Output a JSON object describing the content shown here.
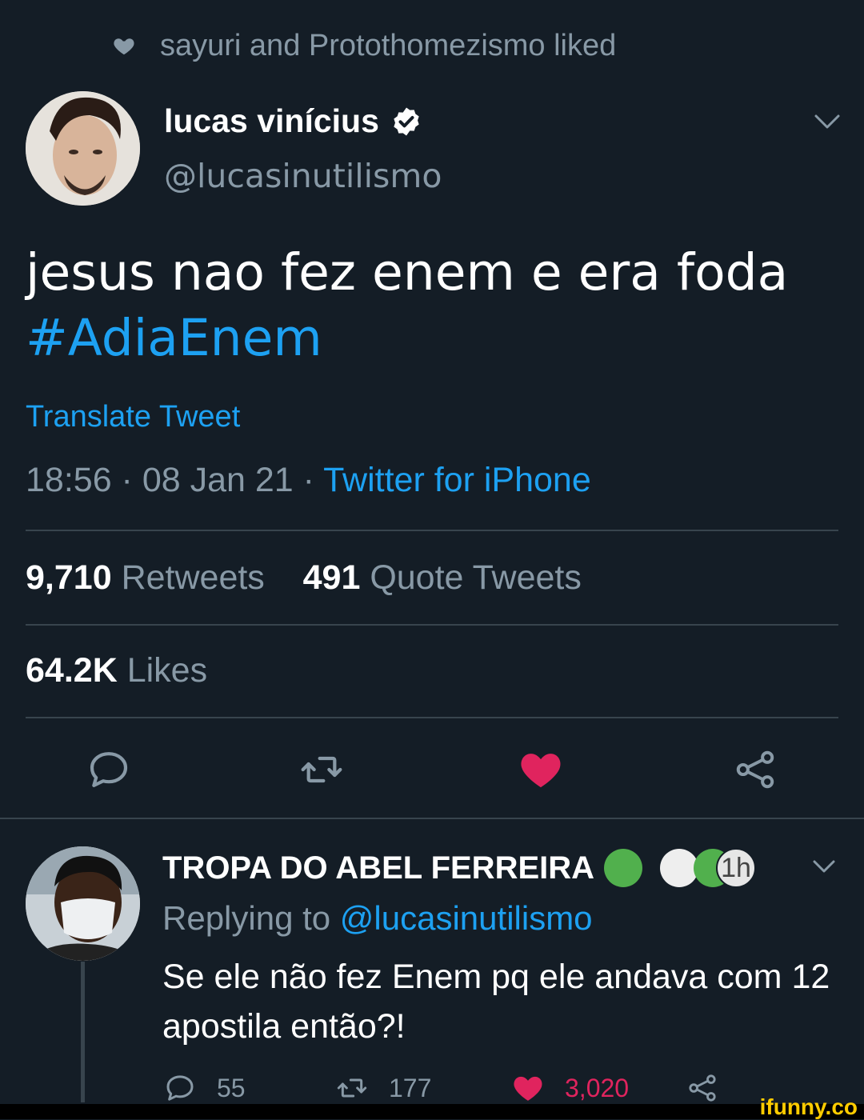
{
  "social_context": {
    "text": "sayuri and Protothomezismo liked",
    "icon": "heart-icon"
  },
  "tweet": {
    "display_name": "lucas vinícius",
    "handle": "@lucasinutilismo",
    "text": "jesus nao fez enem e era foda",
    "hashtag": "#AdiaEnem",
    "translate_label": "Translate Tweet",
    "timestamp": "18:56 · 08 Jan 21 · ",
    "source": "Twitter for iPhone",
    "retweets_count": "9,710",
    "retweets_label": "Retweets",
    "quote_count": "491",
    "quote_label": "Quote Tweets",
    "likes_count": "64.2K",
    "likes_label": "Likes"
  },
  "reply": {
    "display_name": "TROPA DO ABEL FERREIRA",
    "time_badge": "1h",
    "replying_prefix": "Replying to ",
    "replying_handle": "@lucasinutilismo",
    "text": "Se ele não fez Enem pq ele andava com 12 apostila então?!",
    "reply_count": "55",
    "retweet_count": "177",
    "like_count": "3,020"
  },
  "colors": {
    "background": "#141d26",
    "accent": "#1da1f2",
    "like": "#e0245e",
    "muted": "#8899a6"
  },
  "watermark": "ifunny.co"
}
